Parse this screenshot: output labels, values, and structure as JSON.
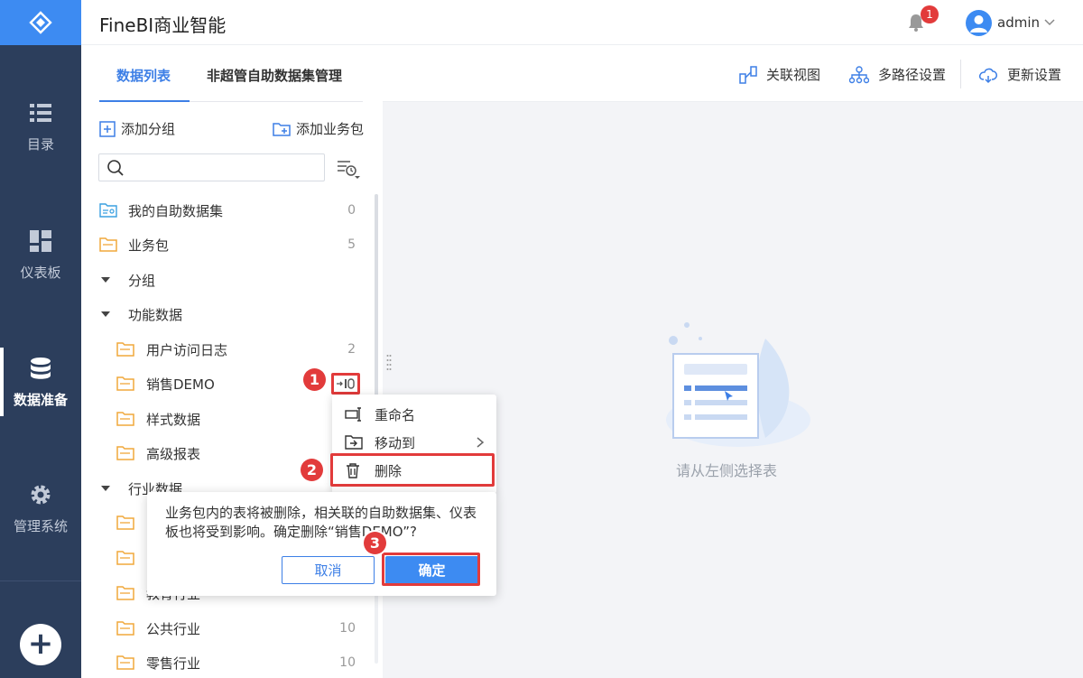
{
  "app": {
    "title": "FineBI商业智能"
  },
  "nav": {
    "items": [
      {
        "label": "目录",
        "icon": "list-icon"
      },
      {
        "label": "仪表板",
        "icon": "dashboard-icon"
      },
      {
        "label": "数据准备",
        "icon": "database-icon",
        "active": true
      },
      {
        "label": "管理系统",
        "icon": "gear-icon"
      }
    ],
    "add_label": "+"
  },
  "header": {
    "notification_count": "1",
    "user": "admin"
  },
  "panel": {
    "tabs": [
      {
        "label": "数据列表",
        "active": true
      },
      {
        "label": "非超管自助数据集管理",
        "active": false
      }
    ],
    "add_group": "添加分组",
    "add_package": "添加业务包",
    "search_placeholder": "",
    "rows": [
      {
        "label": "我的自助数据集",
        "count": "0",
        "icon": "self-dataset-icon"
      },
      {
        "label": "业务包",
        "count": "5",
        "icon": "folder-icon"
      },
      {
        "label": "分组",
        "count": "",
        "icon": "caret-down-icon"
      },
      {
        "label": "功能数据",
        "count": "",
        "icon": "caret-down-icon"
      },
      {
        "label": "用户访问日志",
        "count": "2",
        "icon": "folder-icon"
      },
      {
        "label": "销售DEMO",
        "count": "",
        "icon": "folder-icon"
      },
      {
        "label": "样式数据",
        "count": "",
        "icon": "folder-icon"
      },
      {
        "label": "高级报表",
        "count": "",
        "icon": "folder-icon"
      },
      {
        "label": "行业数据",
        "count": "",
        "icon": "caret-down-icon"
      },
      {
        "label": "",
        "count": "",
        "icon": "folder-icon"
      },
      {
        "label": "",
        "count": "",
        "icon": "folder-icon"
      },
      {
        "label": "教育行业",
        "count": "",
        "icon": "folder-icon"
      },
      {
        "label": "公共行业",
        "count": "10",
        "icon": "folder-icon"
      },
      {
        "label": "零售行业",
        "count": "10",
        "icon": "folder-icon"
      }
    ]
  },
  "toolbar": {
    "relation_view": "关联视图",
    "multipath": "多路径设置",
    "update_settings": "更新设置"
  },
  "empty": {
    "text": "请从左侧选择表"
  },
  "context_menu": {
    "rename": "重命名",
    "move_to": "移动到",
    "delete": "删除"
  },
  "confirm": {
    "message": "业务包内的表将被删除，相关联的自助数据集、仪表板也将受到影响。确定删除“销售DEMO”?",
    "cancel": "取消",
    "ok": "确定"
  },
  "steps": [
    "1",
    "2",
    "3"
  ],
  "colors": {
    "accent": "#3d8bf2",
    "nav_bg": "#2c3e5c",
    "annotation": "#e23b3b",
    "folder": "#f0a83c"
  }
}
